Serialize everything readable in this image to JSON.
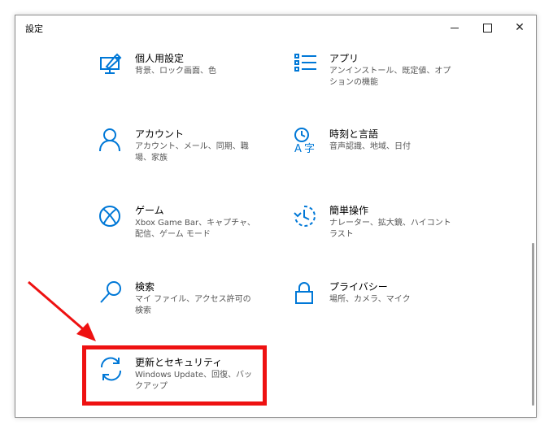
{
  "window": {
    "title": "設定"
  },
  "controls": {
    "minimize": "minimize",
    "maximize": "maximize",
    "close": "close"
  },
  "tiles": [
    {
      "id": "personalization",
      "title": "個人用設定",
      "desc": "背景、ロック画面、色",
      "icon": "personalization-icon"
    },
    {
      "id": "apps",
      "title": "アプリ",
      "desc": "アンインストール、既定値、オプションの機能",
      "icon": "apps-list-icon"
    },
    {
      "id": "accounts",
      "title": "アカウント",
      "desc": "アカウント、メール、同期、職場、家族",
      "icon": "person-icon"
    },
    {
      "id": "time-language",
      "title": "時刻と言語",
      "desc": "音声認識、地域、日付",
      "icon": "time-language-icon"
    },
    {
      "id": "gaming",
      "title": "ゲーム",
      "desc": "Xbox Game Bar、キャプチャ、配信、ゲーム モード",
      "icon": "xbox-icon"
    },
    {
      "id": "ease-of-access",
      "title": "簡単操作",
      "desc": "ナレーター、拡大鏡、ハイコントラスト",
      "icon": "ease-of-access-icon"
    },
    {
      "id": "search",
      "title": "検索",
      "desc": "マイ ファイル、アクセス許可の検索",
      "icon": "search-icon"
    },
    {
      "id": "privacy",
      "title": "プライバシー",
      "desc": "場所、カメラ、マイク",
      "icon": "lock-icon"
    },
    {
      "id": "update-security",
      "title": "更新とセキュリティ",
      "desc": "Windows Update、回復、バックアップ",
      "icon": "sync-icon"
    }
  ],
  "annotation": {
    "highlight_color": "#ee1111",
    "target": "update-security"
  },
  "colors": {
    "accent": "#0078d7",
    "annotation": "#ee1111"
  }
}
